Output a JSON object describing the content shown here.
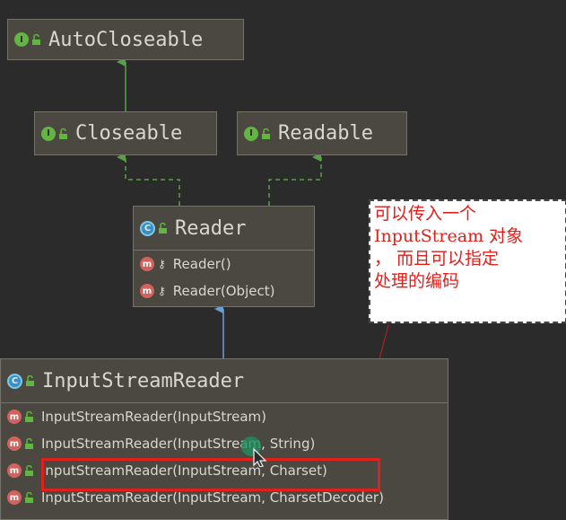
{
  "nodes": {
    "autocloseable": {
      "badge": "I",
      "name": "AutoCloseable"
    },
    "closeable": {
      "badge": "I",
      "name": "Closeable"
    },
    "readable": {
      "badge": "I",
      "name": "Readable"
    },
    "reader": {
      "badge": "C",
      "name": "Reader",
      "members": [
        {
          "badge": "m",
          "signature": "Reader()"
        },
        {
          "badge": "m",
          "signature": "Reader(Object)"
        }
      ]
    },
    "inputstreamreader": {
      "badge": "C",
      "name": "InputStreamReader",
      "members": [
        {
          "badge": "m",
          "signature": "InputStreamReader(InputStream)"
        },
        {
          "badge": "m",
          "signature": "InputStreamReader(InputStream, String)"
        },
        {
          "badge": "m",
          "signature": "InputStreamReader(InputStream, Charset)"
        },
        {
          "badge": "m",
          "signature": "InputStreamReader(InputStream, CharsetDecoder)"
        }
      ]
    }
  },
  "note": {
    "lines": [
      "可以传入一个",
      "InputStream 对象",
      "， 而且可以指定",
      "处理的编码"
    ]
  },
  "colors": {
    "background": "#2b2b2b",
    "node_fill": "#4a4840",
    "interface_badge": "#62b543",
    "class_badge": "#3a8fc1",
    "method_badge": "#d3625d",
    "extends_arrow": "#6a9fd4",
    "implements_arrow": "#5aa047",
    "annotation_red": "#e0201c"
  }
}
